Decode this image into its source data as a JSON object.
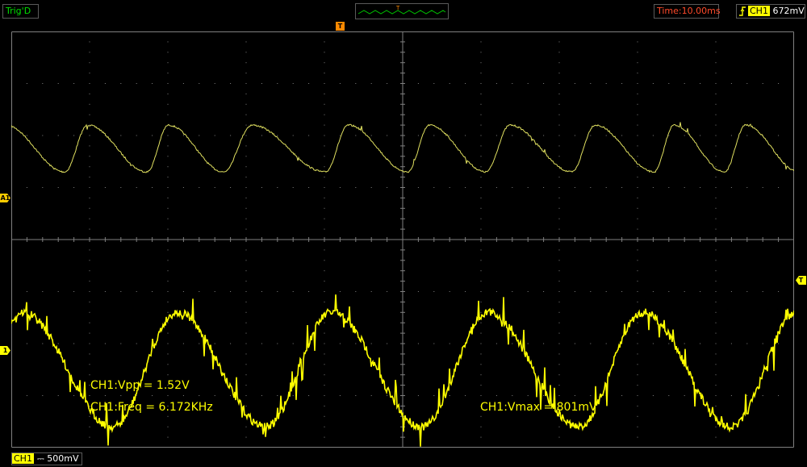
{
  "topbar": {
    "trigger_status": "Trig'D",
    "mini_trigger_label": "T",
    "time_base": "Time:10.00ms",
    "trigger_channel": "CH1",
    "trigger_level": "672mV"
  },
  "screen": {
    "trigger_position_marker": "T",
    "reference_marker_a": "A1",
    "channel_marker": "1",
    "trigger_level_marker": "T"
  },
  "measurements": {
    "vpp": "CH1:Vpp = 1.52V",
    "freq": "CH1:Freq = 6.172KHz",
    "vmax": "CH1:Vmax = 801mV"
  },
  "bottombar": {
    "channel": "CH1",
    "coupling": "⎓",
    "volts_per_div": "500mV"
  },
  "colors": {
    "trace_ch1": "#ffff00",
    "trace_ref": "#e0e060",
    "grid": "#808080",
    "time_text": "#ff4a2a",
    "trig_text": "#00e000"
  },
  "chart_data": {
    "type": "line",
    "grid": true,
    "x_divisions": 10,
    "y_divisions": 8,
    "series": [
      {
        "period_div": [
          1.05,
          1.05,
          0.98,
          1.3,
          1.05,
          1.0,
          1.1,
          1.05,
          0.9,
          0.95
        ],
        "peak_div": 6.2,
        "trough_div": 5.3
      },
      {
        "period_div": [
          2.0,
          1.95,
          2.0,
          2.0,
          1.95
        ],
        "peak_div": 2.6,
        "trough_div": 0.4
      }
    ]
  }
}
